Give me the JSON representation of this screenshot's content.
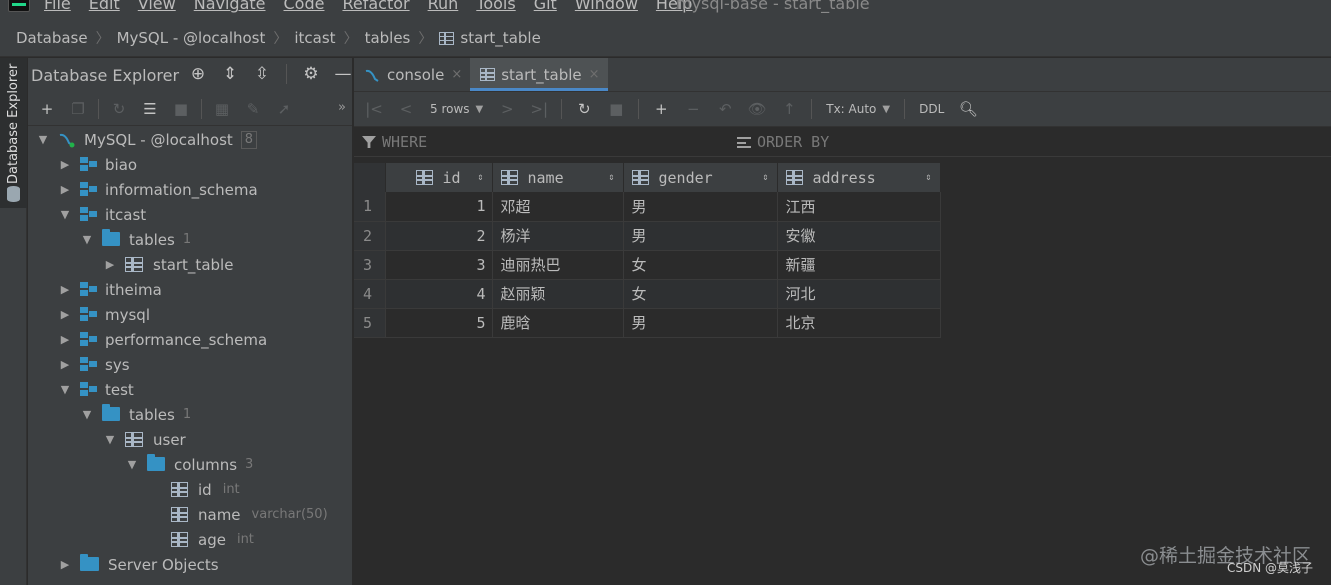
{
  "menu": {
    "items": [
      "File",
      "Edit",
      "View",
      "Navigate",
      "Code",
      "Refactor",
      "Run",
      "Tools",
      "Git",
      "Window",
      "Help"
    ],
    "window_title": "mysql-base - start_table"
  },
  "breadcrumb": {
    "items": [
      "Database",
      "MySQL - @localhost",
      "itcast",
      "tables",
      "start_table"
    ]
  },
  "tool_strip": {
    "label": "Database Explorer"
  },
  "explorer": {
    "title": "Database Explorer",
    "tree": {
      "root": {
        "label": "MySQL - @localhost",
        "count": "8"
      },
      "schemas": {
        "biao": "biao",
        "information_schema": "information_schema",
        "itcast": "itcast",
        "itcast_tables": {
          "label": "tables",
          "count": "1"
        },
        "start_table": "start_table",
        "itheima": "itheima",
        "mysql": "mysql",
        "performance_schema": "performance_schema",
        "sys": "sys",
        "test": "test",
        "test_tables": {
          "label": "tables",
          "count": "1"
        },
        "user": "user",
        "columns": {
          "label": "columns",
          "count": "3"
        },
        "col_id": {
          "label": "id",
          "type": "int"
        },
        "col_name": {
          "label": "name",
          "type": "varchar(50)"
        },
        "col_age": {
          "label": "age",
          "type": "int"
        },
        "server_objects": "Server Objects"
      }
    }
  },
  "editor": {
    "tabs": [
      {
        "label": "console",
        "close": "×"
      },
      {
        "label": "start_table",
        "close": "×"
      }
    ],
    "toolbar": {
      "rows_label": "5 rows",
      "tx_label": "Tx: Auto",
      "ddl_label": "DDL"
    },
    "filter": {
      "where": "WHERE",
      "order_by": "ORDER BY"
    },
    "table": {
      "columns": [
        "id",
        "name",
        "gender",
        "address"
      ],
      "rows": [
        {
          "n": "1",
          "id": "1",
          "name": "邓超",
          "gender": "男",
          "address": "江西"
        },
        {
          "n": "2",
          "id": "2",
          "name": "杨洋",
          "gender": "男",
          "address": "安徽"
        },
        {
          "n": "3",
          "id": "3",
          "name": "迪丽热巴",
          "gender": "女",
          "address": "新疆"
        },
        {
          "n": "4",
          "id": "4",
          "name": "赵丽颖",
          "gender": "女",
          "address": "河北"
        },
        {
          "n": "5",
          "id": "5",
          "name": "鹿晗",
          "gender": "男",
          "address": "北京"
        }
      ]
    }
  },
  "watermark": {
    "line1": "@稀土掘金技术社区",
    "line2": "CSDN @莫浅子"
  },
  "colors": {
    "accent": "#4a88c7",
    "schema_blue": "#3592c4",
    "background": "#2b2b2b",
    "panel": "#3c3f41"
  }
}
